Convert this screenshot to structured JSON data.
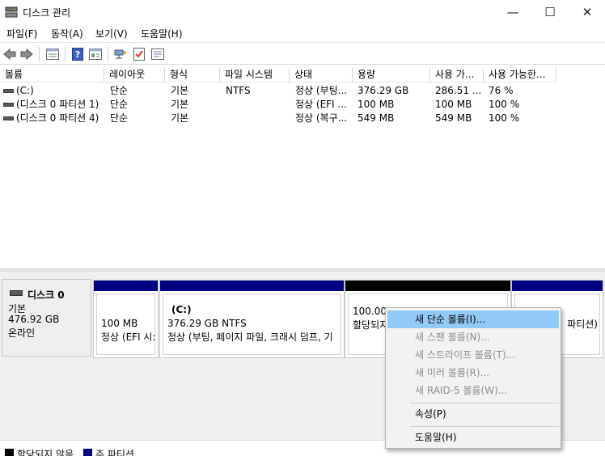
{
  "window": {
    "title": "디스크 관리",
    "controls": {
      "minimize": "—",
      "maximize": "☐",
      "close": "✕"
    }
  },
  "menu": [
    "파일(F)",
    "동작(A)",
    "보기(V)",
    "도움말(H)"
  ],
  "toolbar_icons": [
    "back-arrow-icon",
    "forward-arrow-icon",
    "disk-list-icon",
    "help-icon",
    "properties-icon",
    "connect-icon",
    "check-icon",
    "settings-icon"
  ],
  "volume_list": {
    "columns": [
      "볼륨",
      "레이아웃",
      "형식",
      "파일 시스템",
      "상태",
      "용량",
      "사용 가...",
      "사용 가능한..."
    ],
    "rows": [
      [
        "(C:)",
        "단순",
        "기본",
        "NTFS",
        "정상 (부팅...",
        "376.29 GB",
        "286.51 ...",
        "76 %"
      ],
      [
        "(디스크 0 파티션 1)",
        "단순",
        "기본",
        "",
        "정상 (EFI ...",
        "100 MB",
        "100 MB",
        "100 %"
      ],
      [
        "(디스크 0 파티션 4)",
        "단순",
        "기본",
        "",
        "정상 (복구...",
        "549 MB",
        "549 MB",
        "100 %"
      ]
    ]
  },
  "disk0": {
    "name": "디스크 0",
    "type": "기본",
    "size": "476.92 GB",
    "status": "온라인",
    "partitions": [
      {
        "line1": "",
        "line2": "100 MB",
        "line3": "정상 (EFI 시:"
      },
      {
        "line1": "(C:)",
        "line2": "376.29 GB NTFS",
        "line3": "정상 (부팅, 페이지 파일, 크래시 덤프, 기"
      },
      {
        "line1": "",
        "line2": "100.00",
        "line3": "할당되지"
      },
      {
        "line1": "",
        "line2": "",
        "line3": "파티션)"
      }
    ]
  },
  "legend": [
    {
      "label": "할당되지 않음",
      "color": "#000000"
    },
    {
      "label": "주 파티션",
      "color": "#000080"
    }
  ],
  "context_menu": [
    {
      "label": "새 단순 볼륨(I)...",
      "enabled": true,
      "highlighted": true
    },
    {
      "label": "새 스팬 볼륨(N)...",
      "enabled": false
    },
    {
      "label": "새 스트라이프 볼륨(T)...",
      "enabled": false
    },
    {
      "label": "새 미러 볼륨(R)...",
      "enabled": false
    },
    {
      "label": "새 RAID-5 볼륨(W)...",
      "enabled": false
    },
    {
      "label": "속성(P)",
      "enabled": true
    },
    {
      "label": "도움말(H)",
      "enabled": true
    }
  ],
  "colors": {
    "primary_partition": "#000080",
    "unallocated": "#000000",
    "menu_highlight": "#91c9f7"
  }
}
